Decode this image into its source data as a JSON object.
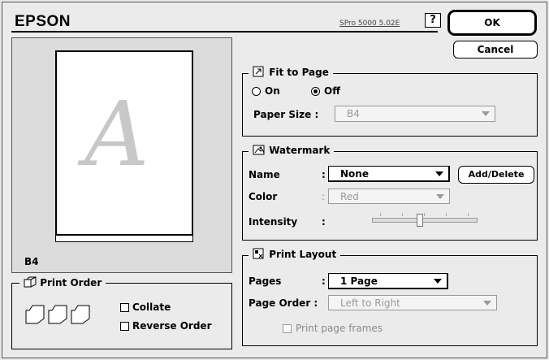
{
  "header": {
    "brand": "EPSON",
    "version": "SPro 5000 5.02E",
    "help_label": "?"
  },
  "buttons": {
    "ok": "OK",
    "cancel": "Cancel"
  },
  "preview": {
    "paper_size": "B4",
    "letter": "A"
  },
  "print_order": {
    "title": "Print Order",
    "collate_label": "Collate",
    "collate_checked": false,
    "reverse_label": "Reverse Order",
    "reverse_checked": false
  },
  "fit_to_page": {
    "title": "Fit to Page",
    "on_label": "On",
    "off_label": "Off",
    "selected": "Off",
    "paper_size_label": "Paper Size :",
    "paper_size_value": "B4"
  },
  "watermark": {
    "title": "Watermark",
    "name_label": "Name",
    "name_value": "None",
    "add_delete_label": "Add/Delete",
    "color_label": "Color",
    "color_value": "Red",
    "intensity_label": "Intensity",
    "intensity_level": 0.45,
    "colon": ":"
  },
  "print_layout": {
    "title": "Print Layout",
    "pages_label": "Pages",
    "pages_value": "1 Page",
    "page_order_label": "Page Order :",
    "page_order_value": "Left to Right",
    "frames_label": "Print page frames",
    "frames_checked": false,
    "colon": ":"
  }
}
